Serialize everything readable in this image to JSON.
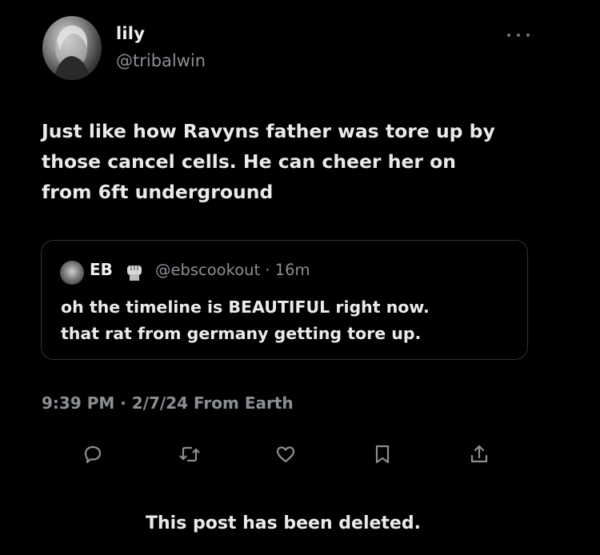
{
  "author": {
    "display_name": "lily",
    "handle": "@tribalwin",
    "avatar": "user-avatar"
  },
  "more_icon": "more-horizontal-icon",
  "tweet": {
    "text": "Just like how Ravyns father was tore up by\nthose cancel cells. He can cheer her on\nfrom 6ft underground"
  },
  "quote": {
    "name": "EB",
    "badge_icon": "raised-fist-icon",
    "meta": "@ebscookout · 16m",
    "text": "oh the timeline is BEAUTIFUL right now.\nthat rat from germany getting tore up."
  },
  "timestamp": "9:39 PM · 2/7/24 From Earth",
  "actions": [
    {
      "icon": "reply-icon"
    },
    {
      "icon": "repost-icon"
    },
    {
      "icon": "like-icon"
    },
    {
      "icon": "bookmark-icon"
    },
    {
      "icon": "share-icon"
    }
  ],
  "deleted_notice": "This post has been deleted.",
  "colors": {
    "background": "#000000",
    "primary_text": "#eaeaea",
    "secondary_text": "#8b8f94",
    "border": "#2f3336"
  }
}
